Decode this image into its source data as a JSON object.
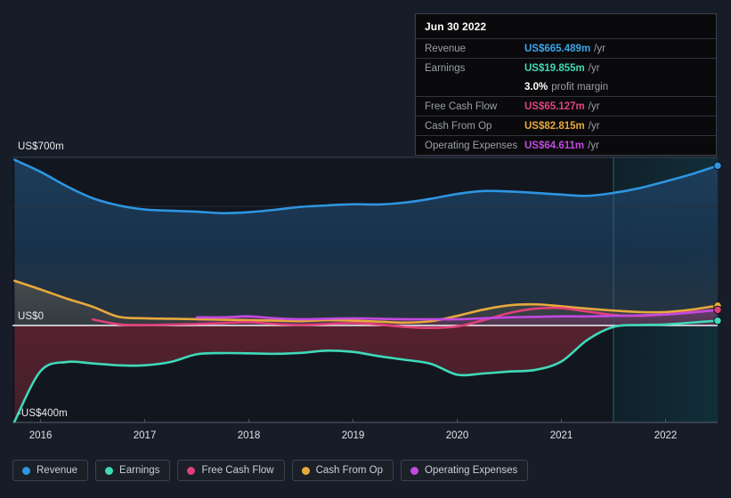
{
  "tooltip": {
    "date": "Jun 30 2022",
    "rows": [
      {
        "label": "Revenue",
        "value": "US$665.489m",
        "unit": "/yr",
        "color": "#3aa6e8"
      },
      {
        "label": "Earnings",
        "value": "US$19.855m",
        "unit": "/yr",
        "color": "#42d9b4"
      },
      {
        "label": "Free Cash Flow",
        "value": "US$65.127m",
        "unit": "/yr",
        "color": "#e0457b"
      },
      {
        "label": "Cash From Op",
        "value": "US$82.815m",
        "unit": "/yr",
        "color": "#e8a93c"
      },
      {
        "label": "Operating Expenses",
        "value": "US$64.611m",
        "unit": "/yr",
        "color": "#c14ae0"
      }
    ],
    "margin_value": "3.0%",
    "margin_label": "profit margin"
  },
  "axes": {
    "y_top_label": "US$700m",
    "y_zero_label": "US$0",
    "y_bottom_label": "-US$400m",
    "x_labels": [
      "2016",
      "2017",
      "2018",
      "2019",
      "2020",
      "2021",
      "2022"
    ]
  },
  "legend": [
    {
      "label": "Revenue",
      "color": "#2e95e0"
    },
    {
      "label": "Earnings",
      "color": "#3fd9b9"
    },
    {
      "label": "Free Cash Flow",
      "color": "#e0407a"
    },
    {
      "label": "Cash From Op",
      "color": "#e8a93c"
    },
    {
      "label": "Operating Expenses",
      "color": "#c14ae0"
    }
  ],
  "chart_data": {
    "type": "area",
    "title": "",
    "xlabel": "",
    "ylabel": "US$",
    "ylim": [
      -400,
      700
    ],
    "xlim": [
      2015.73,
      2022.5
    ],
    "grid": true,
    "gridlines_y": [
      700,
      500,
      0
    ],
    "legend_position": "bottom",
    "forecast_boundary_x": 2021.5,
    "x_tick_values": [
      2016,
      2017,
      2018,
      2019,
      2020,
      2021,
      2022
    ],
    "series": [
      {
        "name": "Revenue",
        "color": "#2e95e0",
        "unit": "US$m",
        "x": [
          2015.75,
          2016.0,
          2016.25,
          2016.5,
          2016.75,
          2017.0,
          2017.25,
          2017.5,
          2017.75,
          2018.0,
          2018.25,
          2018.5,
          2018.75,
          2019.0,
          2019.25,
          2019.5,
          2019.75,
          2020.0,
          2020.25,
          2020.5,
          2020.75,
          2021.0,
          2021.25,
          2021.5,
          2021.75,
          2022.0,
          2022.25,
          2022.5
        ],
        "y": [
          690,
          640,
          580,
          530,
          500,
          483,
          478,
          474,
          468,
          472,
          482,
          494,
          500,
          505,
          504,
          512,
          528,
          548,
          560,
          558,
          552,
          545,
          540,
          552,
          572,
          600,
          630,
          665.489
        ]
      },
      {
        "name": "Earnings",
        "color": "#3fd9b9",
        "unit": "US$m",
        "x": [
          2015.75,
          2016.0,
          2016.25,
          2016.5,
          2016.75,
          2017.0,
          2017.25,
          2017.5,
          2017.75,
          2018.0,
          2018.25,
          2018.5,
          2018.75,
          2019.0,
          2019.25,
          2019.5,
          2019.75,
          2020.0,
          2020.25,
          2020.5,
          2020.75,
          2021.0,
          2021.25,
          2021.5,
          2021.75,
          2022.0,
          2022.25,
          2022.5
        ],
        "y": [
          -400,
          -190,
          -152,
          -158,
          -166,
          -166,
          -152,
          -120,
          -115,
          -116,
          -118,
          -114,
          -105,
          -110,
          -128,
          -143,
          -160,
          -205,
          -200,
          -192,
          -185,
          -150,
          -60,
          -6,
          2,
          4,
          12,
          19.855
        ]
      },
      {
        "name": "Free Cash Flow",
        "color": "#e0407a",
        "unit": "US$m",
        "x": [
          2016.5,
          2016.75,
          2017.0,
          2017.25,
          2017.5,
          2017.75,
          2018.0,
          2018.25,
          2018.5,
          2018.75,
          2019.0,
          2019.25,
          2019.5,
          2019.75,
          2020.0,
          2020.25,
          2020.5,
          2020.75,
          2021.0,
          2021.25,
          2021.5,
          2021.75,
          2022.0,
          2022.25,
          2022.5
        ],
        "y": [
          25,
          5,
          2,
          4,
          6,
          10,
          14,
          6,
          2,
          6,
          10,
          4,
          -6,
          -10,
          -4,
          22,
          52,
          70,
          72,
          58,
          44,
          40,
          46,
          56,
          65.127
        ]
      },
      {
        "name": "Cash From Op",
        "color": "#e8a93c",
        "unit": "US$m",
        "x": [
          2015.75,
          2016.0,
          2016.25,
          2016.5,
          2016.75,
          2017.0,
          2017.25,
          2017.5,
          2017.75,
          2018.0,
          2018.25,
          2018.5,
          2018.75,
          2019.0,
          2019.25,
          2019.5,
          2019.75,
          2020.0,
          2020.25,
          2020.5,
          2020.75,
          2021.0,
          2021.25,
          2021.5,
          2021.75,
          2022.0,
          2022.25,
          2022.5
        ],
        "y": [
          186,
          150,
          112,
          78,
          36,
          30,
          28,
          26,
          24,
          22,
          20,
          18,
          22,
          20,
          16,
          12,
          18,
          40,
          66,
          84,
          88,
          80,
          70,
          62,
          56,
          56,
          66,
          82.815
        ]
      },
      {
        "name": "Operating Expenses",
        "color": "#c14ae0",
        "unit": "US$m",
        "x": [
          2017.5,
          2017.75,
          2018.0,
          2018.25,
          2018.5,
          2018.75,
          2019.0,
          2019.25,
          2019.5,
          2019.75,
          2020.0,
          2020.25,
          2020.5,
          2020.75,
          2021.0,
          2021.25,
          2021.5,
          2021.75,
          2022.0,
          2022.25,
          2022.5
        ],
        "y": [
          34,
          34,
          38,
          30,
          26,
          28,
          30,
          28,
          26,
          26,
          26,
          30,
          34,
          36,
          38,
          38,
          40,
          42,
          46,
          54,
          64.611
        ]
      }
    ]
  }
}
